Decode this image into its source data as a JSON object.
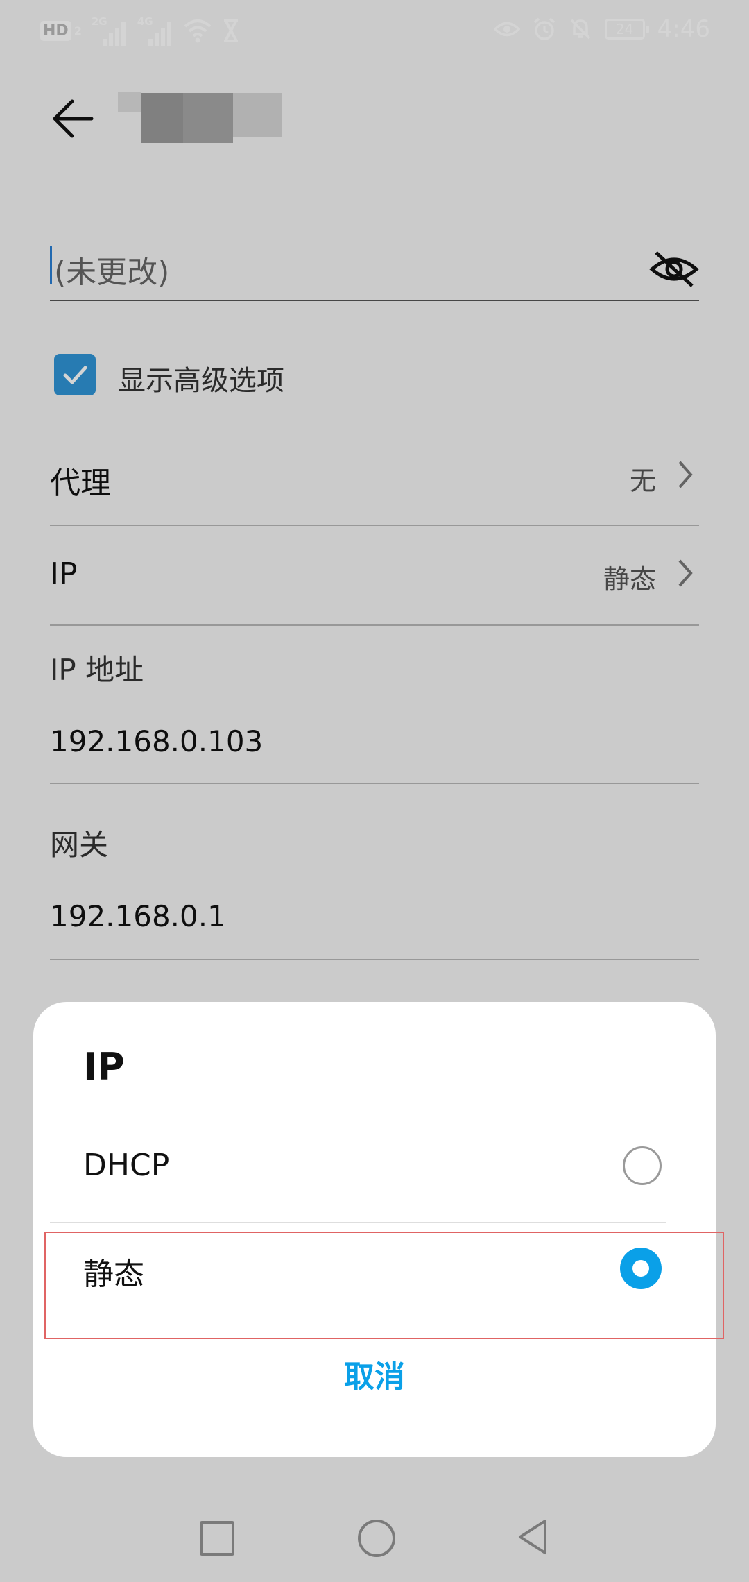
{
  "status_bar": {
    "hd_label": "HD",
    "hd_sim": "2",
    "sim1_type": "2G",
    "sim2_type": "4G",
    "battery": "24",
    "time": "4:46",
    "icons": [
      "hd-icon",
      "signal-icon",
      "signal-icon",
      "wifi-icon",
      "hourglass-icon",
      "eye-icon",
      "alarm-icon",
      "mute-icon",
      "battery-icon"
    ]
  },
  "header": {
    "back_icon": "arrow-left-icon"
  },
  "password": {
    "placeholder": "(未更改)",
    "toggle_icon": "eye-slash-icon"
  },
  "advanced": {
    "checked": true,
    "label": "显示高级选项"
  },
  "settings": {
    "proxy": {
      "label": "代理",
      "value": "无"
    },
    "ip": {
      "label": "IP",
      "value": "静态"
    },
    "ip_address": {
      "label": "IP 地址",
      "value": "192.168.0.103"
    },
    "gateway": {
      "label": "网关",
      "value": "192.168.0.1"
    }
  },
  "dialog": {
    "title": "IP",
    "options": [
      {
        "label": "DHCP",
        "selected": false
      },
      {
        "label": "静态",
        "selected": true
      }
    ],
    "cancel_label": "取消"
  },
  "colors": {
    "accent": "#0aa0e8",
    "checkbox": "#2f95d6",
    "highlight_border": "#e06464"
  }
}
